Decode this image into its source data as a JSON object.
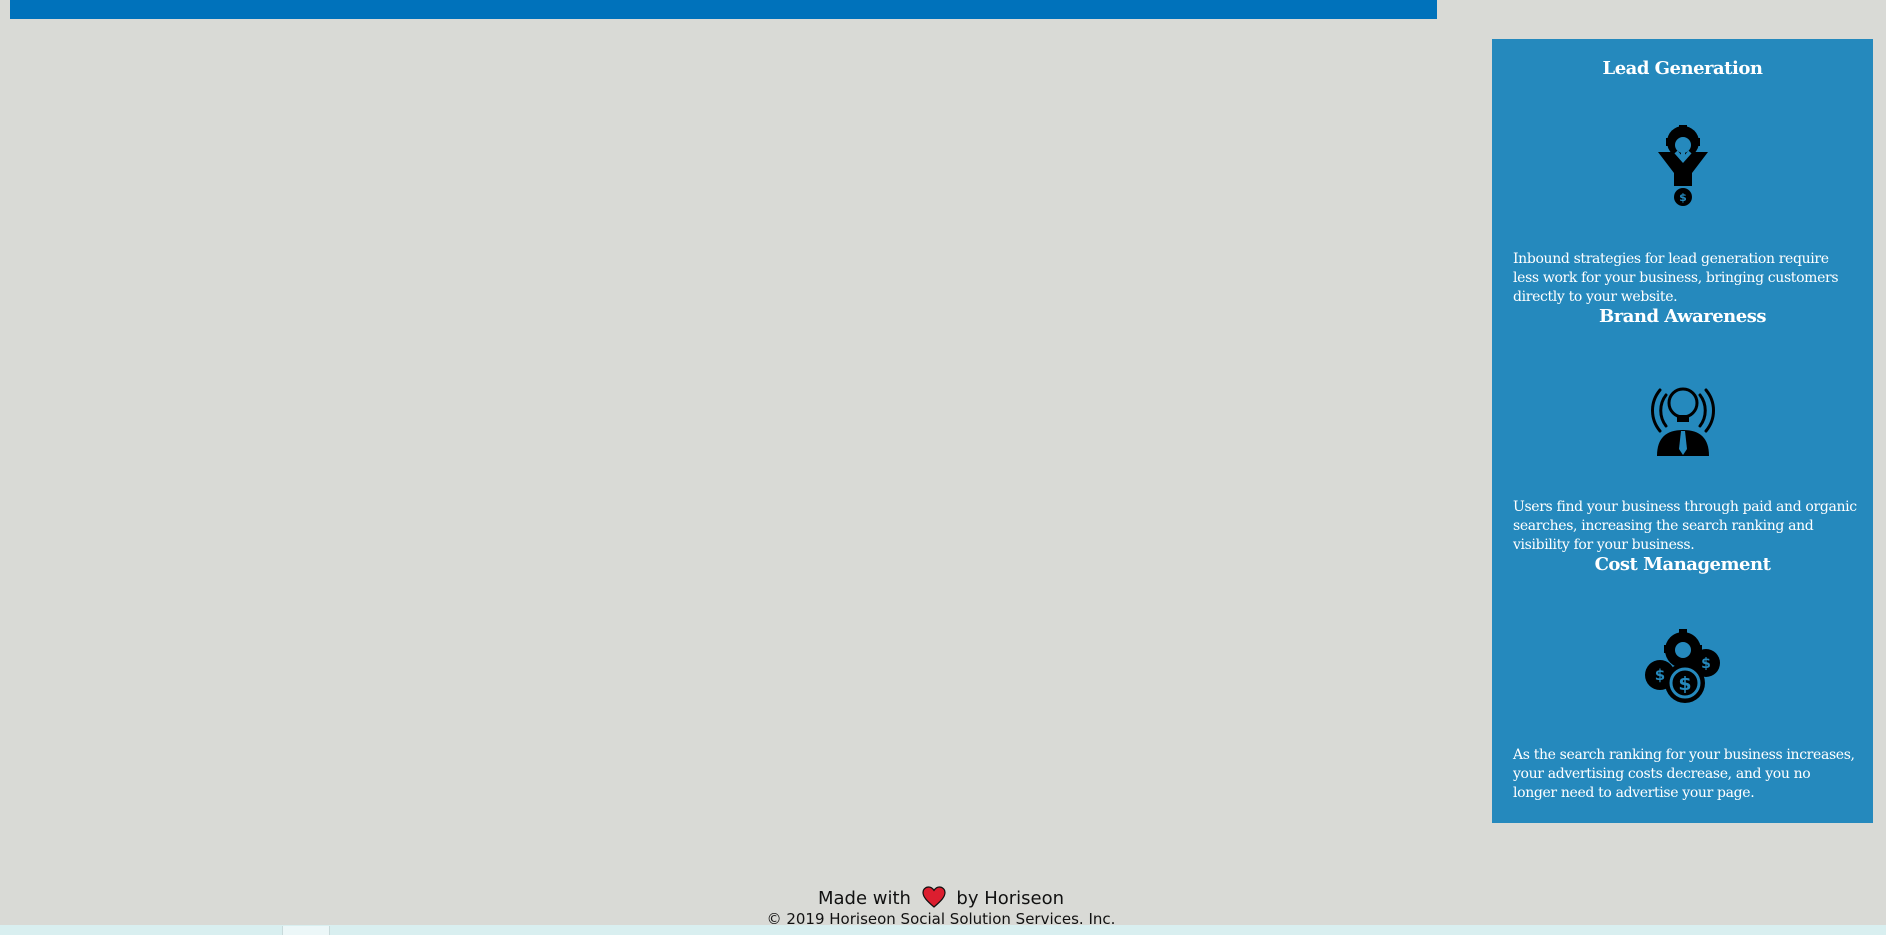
{
  "colors": {
    "background": "#d9dad6",
    "top_bar": "#0072bb",
    "sidebar": "#2589bd",
    "sidebar_text": "#ffffff",
    "footer_text": "#111111",
    "heart": "#dc1e2f"
  },
  "benefits": [
    {
      "title": "Lead Generation",
      "icon": "lead-generation-funnel-icon",
      "text": "Inbound strategies for lead generation require less work for your business, bringing customers directly to your website."
    },
    {
      "title": "Brand Awareness",
      "icon": "brand-awareness-lightbulb-person-icon",
      "text": "Users find your business through paid and organic searches, increasing the search ranking and visibility for your business."
    },
    {
      "title": "Cost Management",
      "icon": "cost-management-coins-gear-icon",
      "text": "As the search ranking for your business increases, your advertising costs decrease, and you no longer need to advertise your page."
    }
  ],
  "footer": {
    "made_prefix": "Made with",
    "heart_icon": "heart-icon",
    "made_suffix": "by Horiseon",
    "copyright": "© 2019 Horiseon Social Solution Services. Inc."
  }
}
